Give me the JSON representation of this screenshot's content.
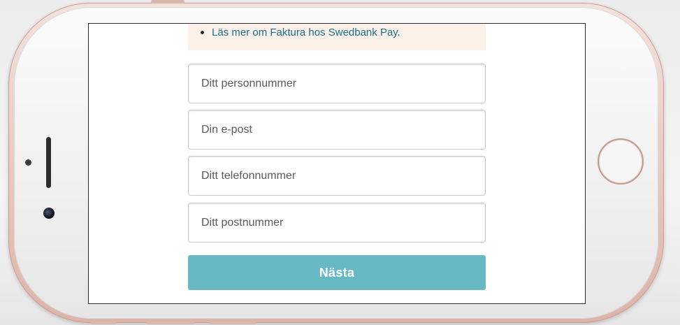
{
  "info": {
    "items": [
      {
        "label": "Läs mer om Faktura hos Swedbank Pay."
      }
    ]
  },
  "form": {
    "personal_number": {
      "placeholder": "Ditt personnummer",
      "value": ""
    },
    "email": {
      "placeholder": "Din e-post",
      "value": ""
    },
    "phone": {
      "placeholder": "Ditt telefonnummer",
      "value": ""
    },
    "postal_code": {
      "placeholder": "Ditt postnummer",
      "value": ""
    },
    "next_label": "Nästa"
  },
  "colors": {
    "accent_button": "#67bac5",
    "link": "#1a6f8b",
    "info_background": "#fbf1e8",
    "phone_frame": "#e9cbc2"
  },
  "icons": {
    "home_button": "home-button-ring",
    "bullet": "bullet-dot"
  }
}
